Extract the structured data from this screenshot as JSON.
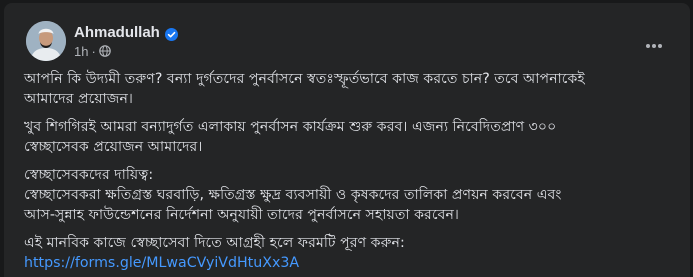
{
  "post": {
    "author": "Ahmadullah",
    "time": "1h",
    "separator": "·",
    "paragraphs": [
      {
        "lines": [
          "আপনি কি উদ্যমী তরুণ? বন্যা দুর্গতদের পুনর্বাসনে স্বতঃস্ফূর্তভাবে কাজ করতে চান? তবে আপনাকেই",
          "আমাদের প্রয়োজন।"
        ]
      },
      {
        "lines": [
          "খুব শিগগিরই আমরা বন্যাদুর্গত এলাকায় পুনর্বাসন কার্যক্রম শুরু করব। এজন্য নিবেদিতপ্রাণ ৩০০",
          "স্বেচ্ছাসেবক প্রয়োজন আমাদের।"
        ]
      },
      {
        "lines": [
          "স্বেচ্ছাসেবকদের দায়িত্ব:",
          "স্বেচ্ছাসেবকরা ক্ষতিগ্রস্ত ঘরবাড়ি,  ক্ষতিগ্রস্ত ক্ষুদ্র ব্যবসায়ী ও কৃষকদের তালিকা প্রণয়ন করবেন এবং",
          "আস-সুন্নাহ ফাউন্ডেশনের নির্দেশনা অনুযায়ী তাদের পুনর্বাসনে সহায়তা করবেন।"
        ]
      },
      {
        "lines": [
          "এই মানবিক কাজে স্বেচ্ছাসেবা দিতে আগ্রহী হলে ফরমটি পূরণ করুন:"
        ]
      }
    ],
    "link": "https://forms.gle/MLwaCVyiVdHtuXx3A"
  },
  "icons": {
    "verified": "verified-badge-icon",
    "audience": "globe-icon",
    "menu": "more-options-icon"
  },
  "colors": {
    "background": "#18191a",
    "card": "#242526",
    "text": "#e4e6eb",
    "secondary": "#b0b3b8",
    "link": "#4599ff",
    "verified": "#1877f2"
  }
}
